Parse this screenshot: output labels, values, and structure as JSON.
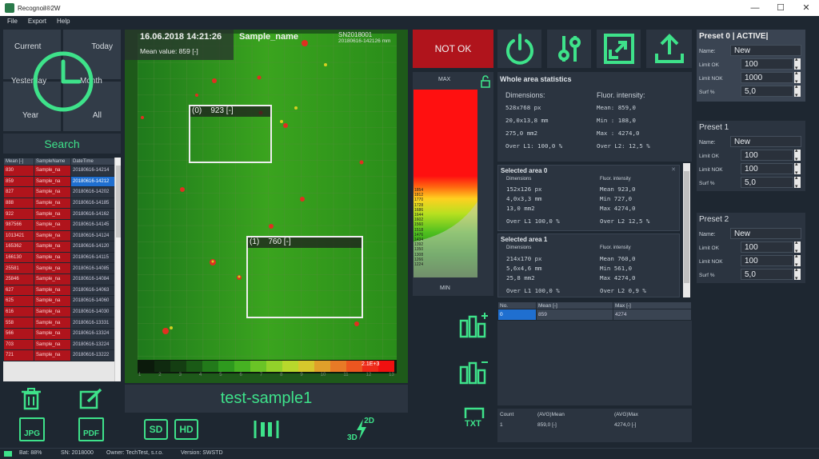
{
  "window": {
    "title": "Recognoil®2W",
    "min": "—",
    "max": "☐",
    "close": "✕"
  },
  "menu": [
    "File",
    "Export",
    "Help"
  ],
  "time_filters": {
    "current": "Current",
    "today": "Today",
    "yesterday": "Yesterday",
    "month": "Month",
    "year": "Year",
    "all": "All"
  },
  "search_label": "Search",
  "sample_table": {
    "headers": [
      "Mean [-]",
      "SampleName",
      "DateTime"
    ],
    "rows": [
      [
        "830",
        "Sample_na",
        "20180616-14214"
      ],
      [
        "859",
        "Sample_na",
        "20180616-14212"
      ],
      [
        "827",
        "Sample_na",
        "20180616-14202"
      ],
      [
        "888",
        "Sample_na",
        "20180616-14185"
      ],
      [
        "922",
        "Sample_na",
        "20180616-14162"
      ],
      [
        "987566",
        "Sample_na",
        "20180616-14145"
      ],
      [
        "1013421",
        "Sample_na",
        "20180616-14124"
      ],
      [
        "165362",
        "Sample_na",
        "20180616-14120"
      ],
      [
        "166130",
        "Sample_na",
        "20180616-14115"
      ],
      [
        "25581",
        "Sample_na",
        "20180616-14085"
      ],
      [
        "25846",
        "Sample_na",
        "20180616-14084"
      ],
      [
        "627",
        "Sample_na",
        "20180616-14063"
      ],
      [
        "625",
        "Sample_na",
        "20180616-14060"
      ],
      [
        "616",
        "Sample_na",
        "20180616-14030"
      ],
      [
        "558",
        "Sample_na",
        "20180616-13331"
      ],
      [
        "566",
        "Sample_na",
        "20180616-13324"
      ],
      [
        "703",
        "Sample_na",
        "20180616-13224"
      ],
      [
        "721",
        "Sample_na",
        "20180616-13222"
      ]
    ],
    "selected_row": 1
  },
  "image_view": {
    "datetime": "16.06.2018 14:21:26",
    "sample_name": "Sample_name",
    "sn": "SN2018001",
    "file_id": "20180616-142126 mm",
    "mean_value": "Mean value: 859 [-]",
    "area0_label": "(0)    923 [-]",
    "area1_label": "(1)    760 [-]",
    "scale_max": "2.1E+3",
    "axis_ticks": [
      "1",
      "2",
      "3",
      "4",
      "5",
      "6",
      "7",
      "8",
      "9",
      "10",
      "11",
      "12",
      "13"
    ]
  },
  "sample_title": "test-sample1",
  "status_button": "NOT OK",
  "colorbar": {
    "max_label": "MAX",
    "min_label": "MIN",
    "ticks": [
      "1854",
      "1812",
      "1770",
      "1728",
      "1686",
      "1644",
      "1602",
      "1560",
      "1518",
      "1476",
      "1434",
      "1392",
      "1350",
      "1308",
      "1266",
      "1224"
    ]
  },
  "whole_area": {
    "title": "Whole area statistics",
    "dim_label": "Dimensions:",
    "fluor_label": "Fluor. intensity:",
    "dims": [
      "528x768 px",
      "20,0x13,8 mm",
      "275,0 mm2",
      "Over L1: 100,0 %"
    ],
    "fluor": [
      "Mean: 859,0",
      "Min : 188,0",
      "Max : 4274,0",
      "Over L2: 12,5 %"
    ]
  },
  "selected_areas": [
    {
      "title": "Selected area 0",
      "dim_label": "Dimensions",
      "fluor_label": "Fluor. intensity",
      "dims": [
        "152x126 px",
        "4,0x3,3 mm",
        "13,0 mm2",
        "Over L1 100,0 %"
      ],
      "fluor": [
        "Mean 923,0",
        "Min  727,0",
        "Max  4274,0",
        "Over L2 12,5 %"
      ]
    },
    {
      "title": "Selected area 1",
      "dim_label": "Dimensions",
      "fluor_label": "Fluor. intensity",
      "dims": [
        "214x170 px",
        "5,6x4,6 mm",
        "25,8 mm2",
        "Over L1 100,0 %"
      ],
      "fluor": [
        "Mean 760,0",
        "Min  561,0",
        "Max  4274,0",
        "Over L2 0,9 %"
      ]
    }
  ],
  "results_table": {
    "headers": [
      "No.",
      "Mean [-]",
      "Max [-]"
    ],
    "row": [
      "0",
      "859",
      "4274"
    ]
  },
  "summary_table": {
    "headers": [
      "Count",
      "(AVG)Mean",
      "(AVG)Max"
    ],
    "row": [
      "1",
      "859,0 [-]",
      "4274,0 [-]"
    ]
  },
  "presets": [
    {
      "title": "Preset 0 | ACTIVE|",
      "name_label": "Name:",
      "name": "New",
      "ok_label": "Limit OK",
      "ok": "100",
      "nok_label": "Limit NOK",
      "nok": "1000",
      "surf_label": "Surf %",
      "surf": "5,0"
    },
    {
      "title": "Preset 1",
      "name_label": "Name:",
      "name": "New",
      "ok_label": "Limit OK",
      "ok": "100",
      "nok_label": "Limit NOK",
      "nok": "100",
      "surf_label": "Surf %",
      "surf": "5,0"
    },
    {
      "title": "Preset 2",
      "name_label": "Name:",
      "name": "New",
      "ok_label": "Limit OK",
      "ok": "100",
      "nok_label": "Limit NOK",
      "nok": "100",
      "surf_label": "Surf %",
      "surf": "5,0"
    }
  ],
  "buttons": {
    "jpg": "JPG",
    "pdf": "PDF",
    "sd": "SD",
    "hd": "HD",
    "two_d": "2D",
    "three_d": "3D",
    "txt": "TXT"
  },
  "statusbar": {
    "bat": "Bat: 88%",
    "sn": "SN: 2018000",
    "owner": "Owner: TechTest, s.r.o.",
    "version": "Version: SWSTD"
  },
  "colors": {
    "accent": "#3ee28a",
    "notok": "#b0141c",
    "bg": "#1e2731",
    "panel": "#2b3440"
  }
}
